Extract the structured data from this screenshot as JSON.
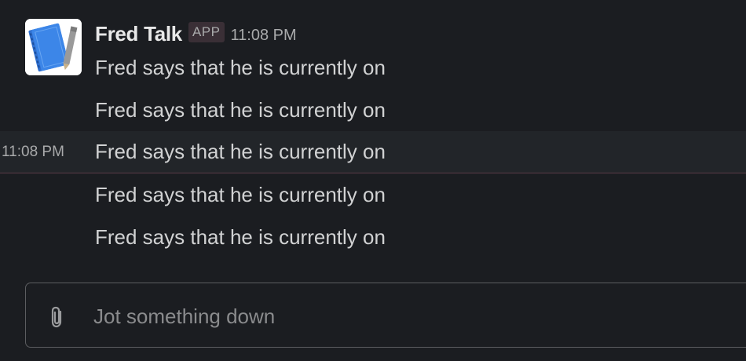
{
  "message": {
    "sender": "Fred Talk",
    "badge": "APP",
    "time": "11:08 PM",
    "avatar_icon": "notebook-icon",
    "lines": [
      "Fred says that he is currently on",
      "Fred says that he is currently on",
      "Fred says that he is currently on",
      "Fred says that he is currently on",
      "Fred says that he is currently on"
    ],
    "hover_time": "11:08 PM"
  },
  "composer": {
    "placeholder": "Jot something down",
    "value": "",
    "attach_icon": "paperclip-icon"
  },
  "colors": {
    "background": "#1b1d21",
    "hover_row": "#222529",
    "text": "#d1d2d3",
    "muted": "#a9aaab",
    "badge_bg": "#3a2f36",
    "composer_border": "#5c5d60"
  }
}
